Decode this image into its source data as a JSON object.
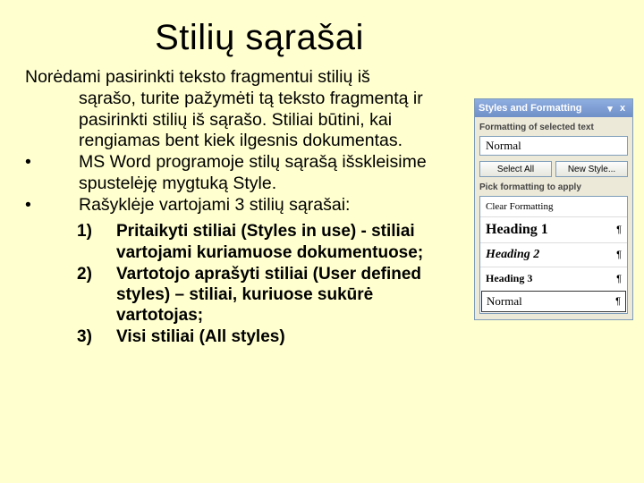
{
  "title": "Stilių sąrašai",
  "body": {
    "lead": "Norėdami pasirinkti teksto fragmentui stilių iš",
    "lead_rest": "sąrašo, turite pažymėti tą teksto fragmentą ir pasirinkti stilių iš sąrašo. Stiliai būtini, kai rengiamas bent kiek ilgesnis dokumentas.",
    "bullets": [
      "MS Word programoje stilų sąrašą išskleisime spustelėję mygtuką Style.",
      "Rašyklėje vartojami 3 stilių sąrašai:"
    ],
    "numbered": [
      "Pritaikyti stiliai (Styles in use) - stiliai vartojami kuriamuose dokumentuose;",
      "Vartotojo aprašyti stiliai (User defined styles) – stiliai, kuriuose sukūrė vartotojas;",
      "Visi stiliai (All styles)"
    ],
    "bullet_char": "•",
    "num_marks": [
      "1)",
      "2)",
      "3)"
    ]
  },
  "pane": {
    "title": "Styles and Formatting",
    "label_current": "Formatting of selected text",
    "current_value": "Normal",
    "btn_select_all": "Select All",
    "btn_new_style": "New Style...",
    "label_pick": "Pick formatting to apply",
    "items": [
      {
        "label": "Clear Formatting",
        "mark": ""
      },
      {
        "label": "Heading 1",
        "mark": "¶",
        "cls": "h1"
      },
      {
        "label": "Heading 2",
        "mark": "¶",
        "cls": "h2"
      },
      {
        "label": "Heading 3",
        "mark": "¶",
        "cls": "h3"
      },
      {
        "label": "Normal",
        "mark": "¶",
        "cls": "nm"
      }
    ],
    "dropdown_icon": "▾",
    "close_icon": "x"
  }
}
